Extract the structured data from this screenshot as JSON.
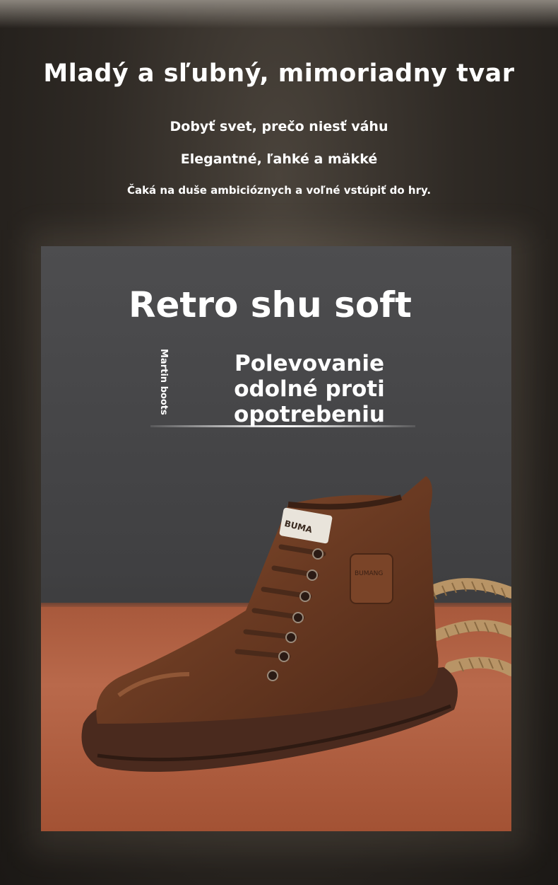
{
  "header": {
    "headline": "Mladý a sľubný, mimoriadny tvar",
    "line1": "Dobyť svet, prečo niesť váhu",
    "line2": "Elegantné, ľahké a mäkké",
    "line3": "Čaká na duše ambicióznych a voľné vstúpiť do hry."
  },
  "product": {
    "title": "Retro shu soft",
    "vertical_tag": "Martin boots",
    "subhead": "Polevovanie odolné proti opotrebeniu",
    "boot_label": "BUMA",
    "patch_label": "BUMANG"
  },
  "colors": {
    "boot_leather": "#6a3a22",
    "sole": "#4a2a1e",
    "table": "#a8593c",
    "backdrop": "#444446"
  }
}
